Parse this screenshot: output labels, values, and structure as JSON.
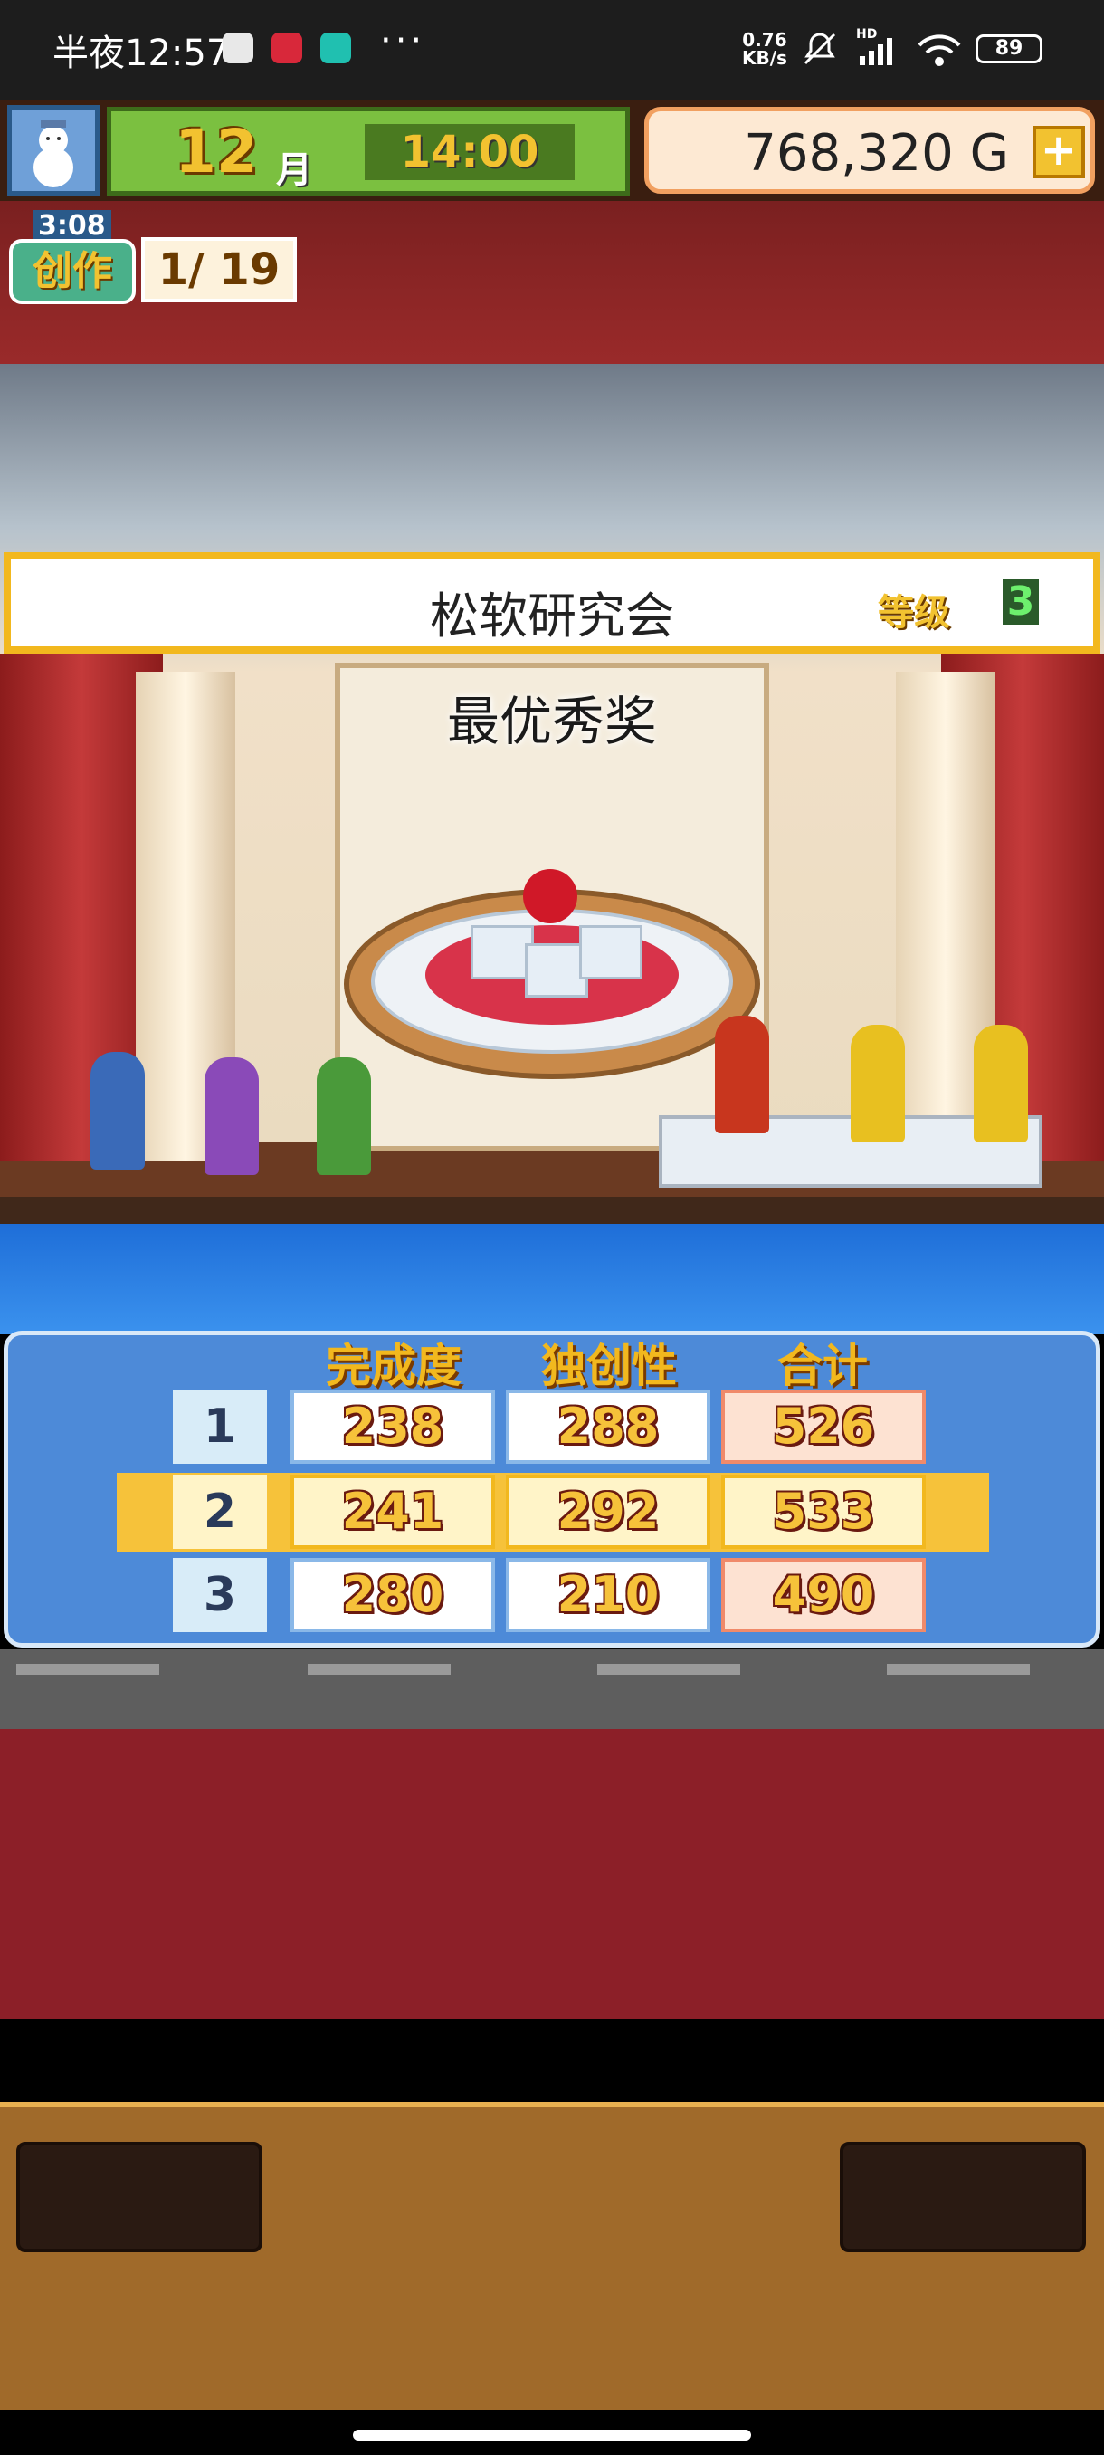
{
  "status_bar": {
    "time": "半夜12:57",
    "dots": "···",
    "net_speed_value": "0.76",
    "net_speed_unit": "KB/s",
    "signal": "HD",
    "battery": "89"
  },
  "hud": {
    "month": "12",
    "month_char": "月",
    "clock": "14:00",
    "money": "768,320 G",
    "add_label": "+"
  },
  "creation": {
    "timer": "3:08",
    "label": "创作",
    "count": "1/ 19"
  },
  "banner": {
    "name": "松软研究会",
    "level_label": "等级",
    "level": "3"
  },
  "award": "最优秀奖",
  "scores": {
    "headers": [
      "完成度",
      "独创性",
      "合计"
    ],
    "rows": [
      {
        "rank": "1",
        "completion": "238",
        "originality": "288",
        "total": "526"
      },
      {
        "rank": "2",
        "completion": "241",
        "originality": "292",
        "total": "533"
      },
      {
        "rank": "3",
        "completion": "280",
        "originality": "210",
        "total": "490"
      }
    ],
    "highlight_rank": "2"
  }
}
